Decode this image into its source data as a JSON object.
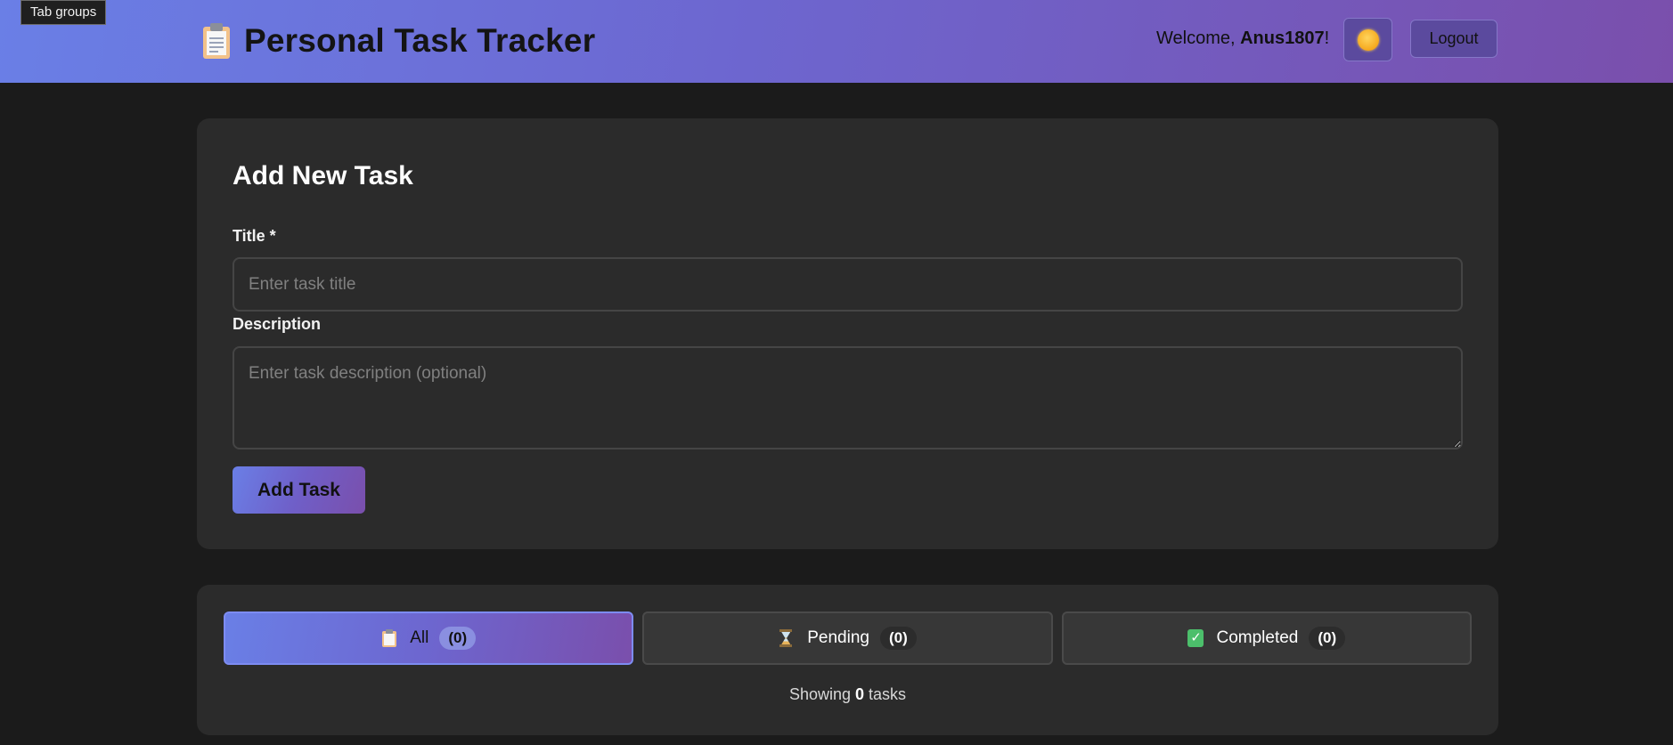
{
  "browser": {
    "tab_groups_label": "Tab groups"
  },
  "header": {
    "title": "Personal Task Tracker",
    "logo_icon": "clipboard-icon",
    "welcome_prefix": "Welcome, ",
    "username": "Anus1807",
    "welcome_suffix": "!",
    "theme_icon": "sun-icon",
    "logout_label": "Logout",
    "gradient_colors": [
      "#6a7fe6",
      "#7a4fac"
    ]
  },
  "add_task": {
    "heading": "Add New Task",
    "title_label": "Title *",
    "title_value": "",
    "title_placeholder": "Enter task title",
    "description_label": "Description",
    "description_value": "",
    "description_placeholder": "Enter task description (optional)",
    "submit_label": "Add Task"
  },
  "filters": {
    "tabs": [
      {
        "icon": "clipboard-icon",
        "label": "All",
        "count": "(0)",
        "active": true
      },
      {
        "icon": "hourglass-icon",
        "label": "Pending",
        "count": "(0)",
        "active": false
      },
      {
        "icon": "check-mark-icon",
        "label": "Completed",
        "count": "(0)",
        "active": false
      }
    ],
    "showing_prefix": "Showing ",
    "showing_count": "0",
    "showing_suffix": " tasks"
  }
}
